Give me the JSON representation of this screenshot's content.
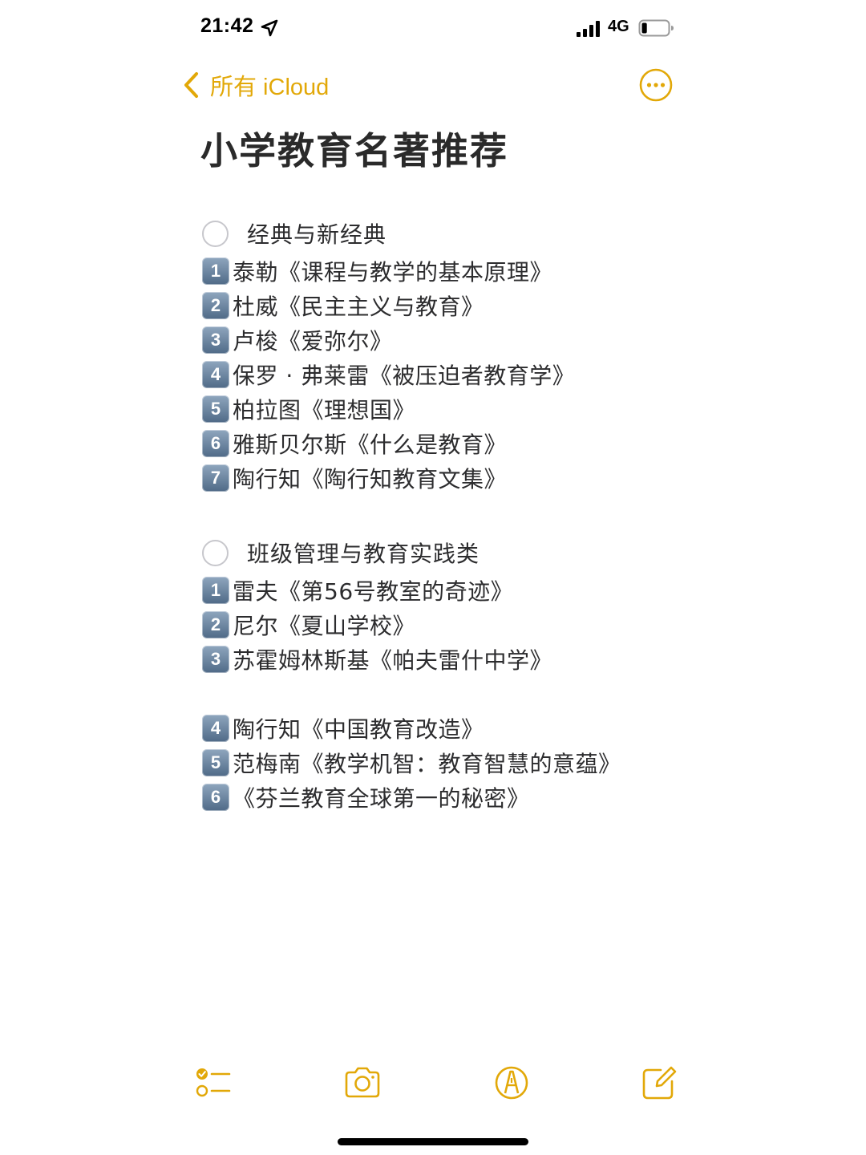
{
  "status_bar": {
    "time": "21:42",
    "network": "4G",
    "battery_level": 0.2
  },
  "nav": {
    "back_label": "所有 iCloud"
  },
  "note": {
    "title": "小学教育名著推荐",
    "sections": [
      {
        "heading": "经典与新经典",
        "books": [
          {
            "num": "1",
            "text": "泰勒《课程与教学的基本原理》"
          },
          {
            "num": "2",
            "text": "杜威《民主主义与教育》"
          },
          {
            "num": "3",
            "text": "卢梭《爱弥尔》"
          },
          {
            "num": "4",
            "text": "保罗 · 弗莱雷《被压迫者教育学》"
          },
          {
            "num": "5",
            "text": "柏拉图《理想国》"
          },
          {
            "num": "6",
            "text": "雅斯贝尔斯《什么是教育》"
          },
          {
            "num": "7",
            "text": "陶行知《陶行知教育文集》"
          }
        ]
      },
      {
        "heading": "班级管理与教育实践类",
        "books": [
          {
            "num": "1",
            "text": "雷夫《第56号教室的奇迹》"
          },
          {
            "num": "2",
            "text": "尼尔《夏山学校》"
          },
          {
            "num": "3",
            "text": "苏霍姆林斯基《帕夫雷什中学》"
          }
        ],
        "books_continued": [
          {
            "num": "4",
            "text": "陶行知《中国教育改造》"
          },
          {
            "num": "5",
            "text": "范梅南《教学机智：教育智慧的意蕴》"
          },
          {
            "num": "6",
            "text": "《芬兰教育全球第一的秘密》"
          }
        ]
      }
    ]
  },
  "toolbar": {
    "icons": [
      "checklist-icon",
      "camera-icon",
      "markup-icon",
      "compose-icon"
    ]
  },
  "colors": {
    "accent": "#e2a808",
    "text": "#2c2c2e",
    "badge": "#5f7a96"
  }
}
